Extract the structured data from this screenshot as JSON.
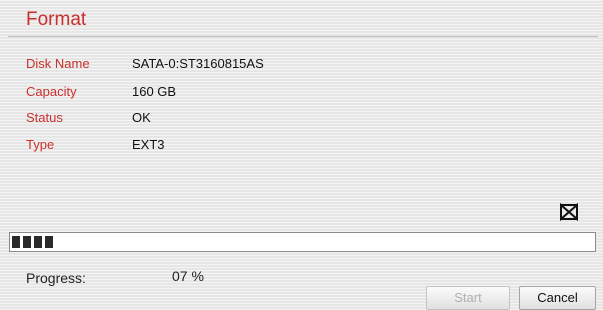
{
  "dialog": {
    "title": "Format"
  },
  "disk_info": [
    {
      "label": "Disk Name",
      "value": "SATA-0:ST3160815AS"
    },
    {
      "label": "Capacity",
      "value": "160 GB"
    },
    {
      "label": "Status",
      "value": "OK"
    },
    {
      "label": "Type",
      "value": "EXT3"
    }
  ],
  "progress": {
    "label": "Progress:",
    "value_text": "07 %",
    "percent": 7
  },
  "buttons": {
    "start_label": "Start",
    "start_enabled": false,
    "cancel_label": "Cancel"
  },
  "icons": {
    "close": "close-icon"
  },
  "colors": {
    "label_red": "#c9302c",
    "progress_fill": "#2a2a2a",
    "button_disabled_text": "#b0b0b0"
  }
}
